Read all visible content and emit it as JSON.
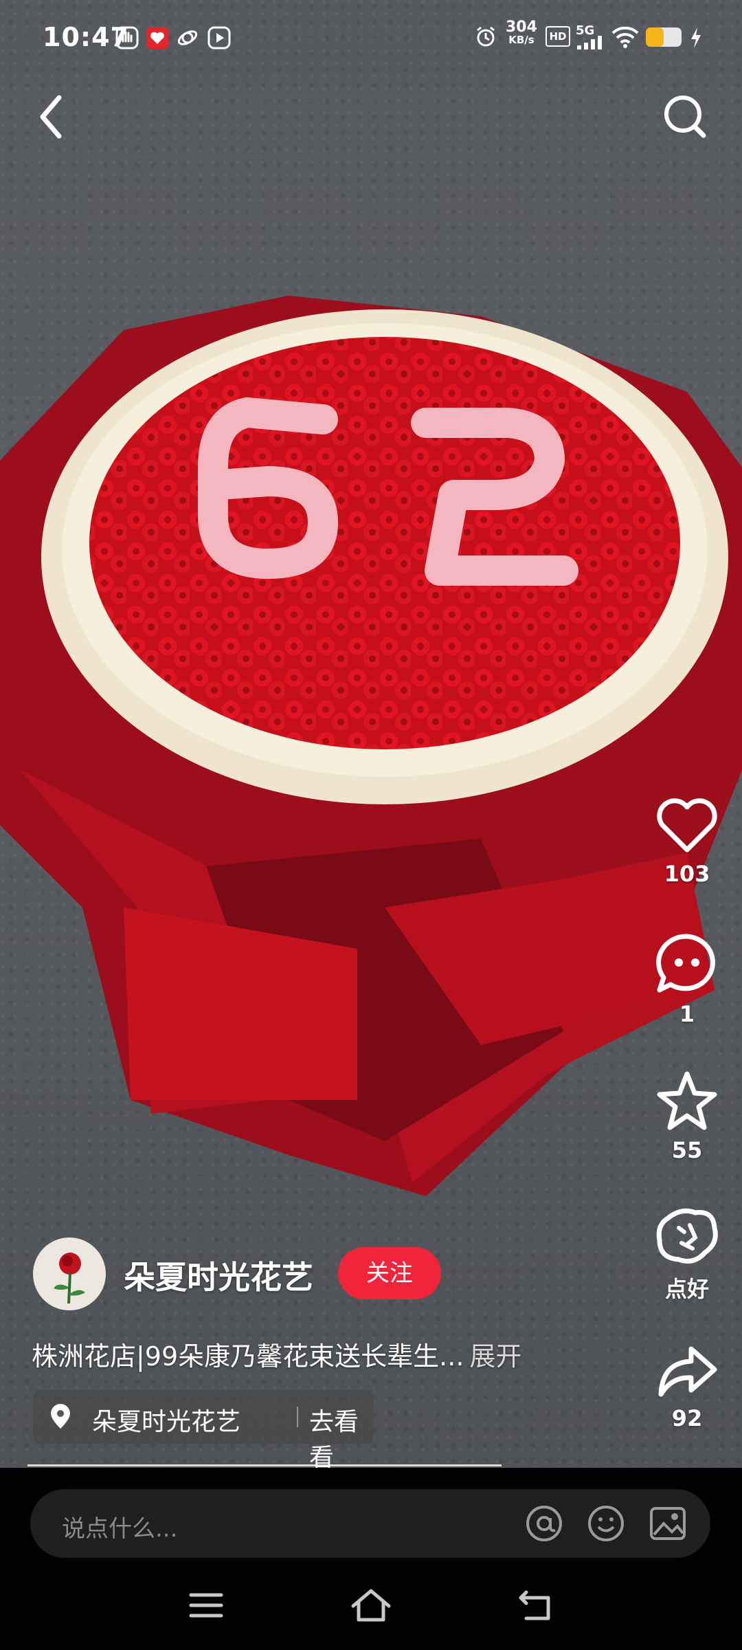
{
  "status_bar": {
    "time": "10:47",
    "network_speed_value": "304",
    "network_speed_unit": "KB/s",
    "hd_badge": "HD",
    "signal_type": "5G",
    "battery_level": 0.5
  },
  "nav": {
    "back_icon": "chevron-left-icon",
    "search_icon": "search-icon"
  },
  "actions": {
    "like_count": "103",
    "comment_count": "1",
    "favorite_count": "55",
    "good_label": "点好",
    "share_count": "92"
  },
  "author": {
    "name": "朵夏时光花艺",
    "follow_label": "关注"
  },
  "post": {
    "description": "株洲花店|99朵康乃馨花束送长辈生...",
    "expand_label": "展开"
  },
  "location": {
    "name": "朵夏时光花艺",
    "go_label": "去看看"
  },
  "comment_bar": {
    "placeholder": "说点什么..."
  },
  "colors": {
    "accent": "#f2243b",
    "carnation_red": "#d9141c",
    "pink_letters": "#f4b7c0",
    "wrap_red": "#a8101e"
  }
}
